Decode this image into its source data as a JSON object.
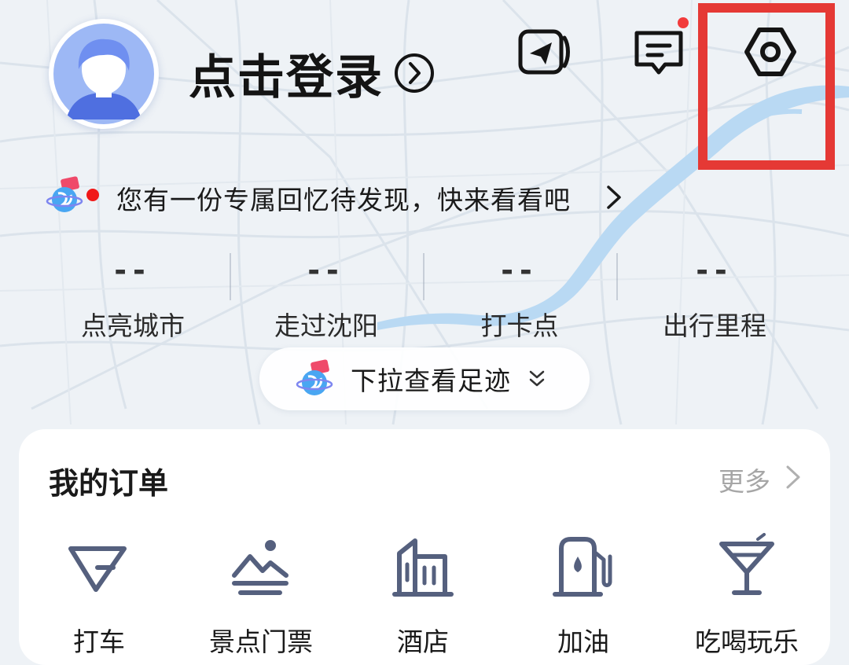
{
  "header": {
    "login_label": "点击登录",
    "icons": [
      "avatar-icon",
      "send-icon",
      "message-icon",
      "settings-icon"
    ]
  },
  "memory_banner": {
    "text": "您有一份专属回忆待发现，快来看看吧"
  },
  "stats": [
    {
      "value": "--",
      "label": "点亮城市"
    },
    {
      "value": "--",
      "label": "走过沈阳"
    },
    {
      "value": "--",
      "label": "打卡点"
    },
    {
      "value": "--",
      "label": "出行里程"
    }
  ],
  "pull_hint": {
    "label": "下拉查看足迹"
  },
  "orders": {
    "title": "我的订单",
    "more": "更多",
    "items": [
      {
        "label": "打车",
        "icon": "taxi-icon"
      },
      {
        "label": "景点门票",
        "icon": "scenic-ticket-icon"
      },
      {
        "label": "酒店",
        "icon": "hotel-icon"
      },
      {
        "label": "加油",
        "icon": "fuel-icon"
      },
      {
        "label": "吃喝玩乐",
        "icon": "cocktail-icon"
      }
    ]
  },
  "colors": {
    "accent_blue": "#4a6fdc",
    "icon_slate": "#55607e",
    "highlight_red": "#e53935",
    "notification_red": "#f23b3b",
    "map_road": "#d6dfe8",
    "map_river": "#b9d9f3"
  }
}
